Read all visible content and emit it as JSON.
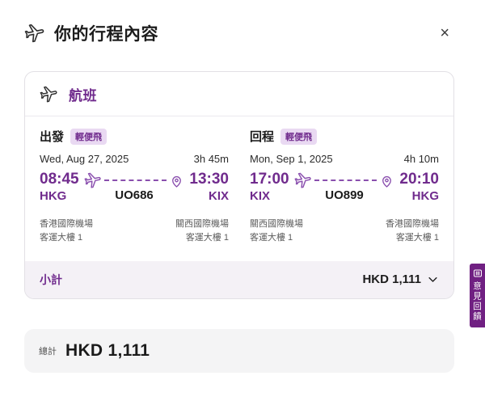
{
  "header": {
    "title": "你的行程內容"
  },
  "icons": {
    "close": "×"
  },
  "card": {
    "section_title": "航班",
    "segments": [
      {
        "direction_label": "出發",
        "badge": "輕便飛",
        "date": "Wed, Aug 27, 2025",
        "duration": "3h 45m",
        "dep_time": "08:45",
        "dep_code": "HKG",
        "arr_time": "13:30",
        "arr_code": "KIX",
        "flight_no": "UO686",
        "dep_airport": "香港國際機場",
        "dep_terminal": "客運大樓 1",
        "arr_airport": "關西國際機場",
        "arr_terminal": "客運大樓 1"
      },
      {
        "direction_label": "回程",
        "badge": "輕便飛",
        "date": "Mon, Sep 1, 2025",
        "duration": "4h 10m",
        "dep_time": "17:00",
        "dep_code": "KIX",
        "arr_time": "20:10",
        "arr_code": "HKG",
        "flight_no": "UO899",
        "dep_airport": "關西國際機場",
        "dep_terminal": "客運大樓 1",
        "arr_airport": "香港國際機場",
        "arr_terminal": "客運大樓 1"
      }
    ],
    "subtotal": {
      "label": "小計",
      "amount": "HKD 1,111"
    }
  },
  "total": {
    "label": "總計",
    "amount": "HKD 1,111"
  },
  "feedback_tab": {
    "label": "意見回饋"
  },
  "colors": {
    "brand_purple": "#702b8d",
    "path_purple": "#8a4fae",
    "badge_bg": "#e9d9f2",
    "subtotal_bg": "#f4f1f6",
    "total_bg": "#f4f4f5",
    "feedback_tab_bg": "#702082",
    "text_dark": "#1c1c1c",
    "text_gray": "#5c5c5c"
  }
}
